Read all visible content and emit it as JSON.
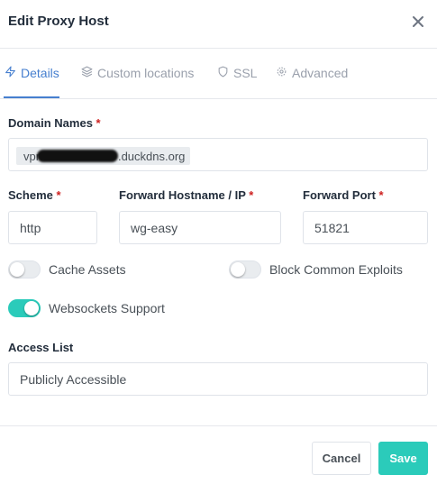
{
  "modal": {
    "title": "Edit Proxy Host"
  },
  "tabs": [
    {
      "label": "Details",
      "icon": "zap-icon",
      "active": true
    },
    {
      "label": "Custom locations",
      "icon": "layers-icon",
      "active": false
    },
    {
      "label": "SSL",
      "icon": "shield-icon",
      "active": false
    },
    {
      "label": "Advanced",
      "icon": "gear-icon",
      "active": false
    }
  ],
  "form": {
    "domain_names": {
      "label": "Domain Names",
      "required_mark": "*",
      "chip_prefix": "vpn",
      "chip_suffix": ".duckdns.org"
    },
    "scheme": {
      "label": "Scheme",
      "required_mark": "*",
      "value": "http"
    },
    "forward_hostname": {
      "label": "Forward Hostname / IP",
      "required_mark": "*",
      "value": "wg-easy"
    },
    "forward_port": {
      "label": "Forward Port",
      "required_mark": "*",
      "value": "51821"
    },
    "cache_assets": {
      "label": "Cache Assets",
      "on": false
    },
    "block_exploits": {
      "label": "Block Common Exploits",
      "on": false
    },
    "websockets": {
      "label": "Websockets Support",
      "on": true
    },
    "access_list": {
      "label": "Access List",
      "value": "Publicly Accessible"
    }
  },
  "footer": {
    "cancel_label": "Cancel",
    "save_label": "Save"
  },
  "colors": {
    "accent": "#467fcf",
    "toggle_on": "#2bcbba",
    "required": "#cd201f"
  }
}
